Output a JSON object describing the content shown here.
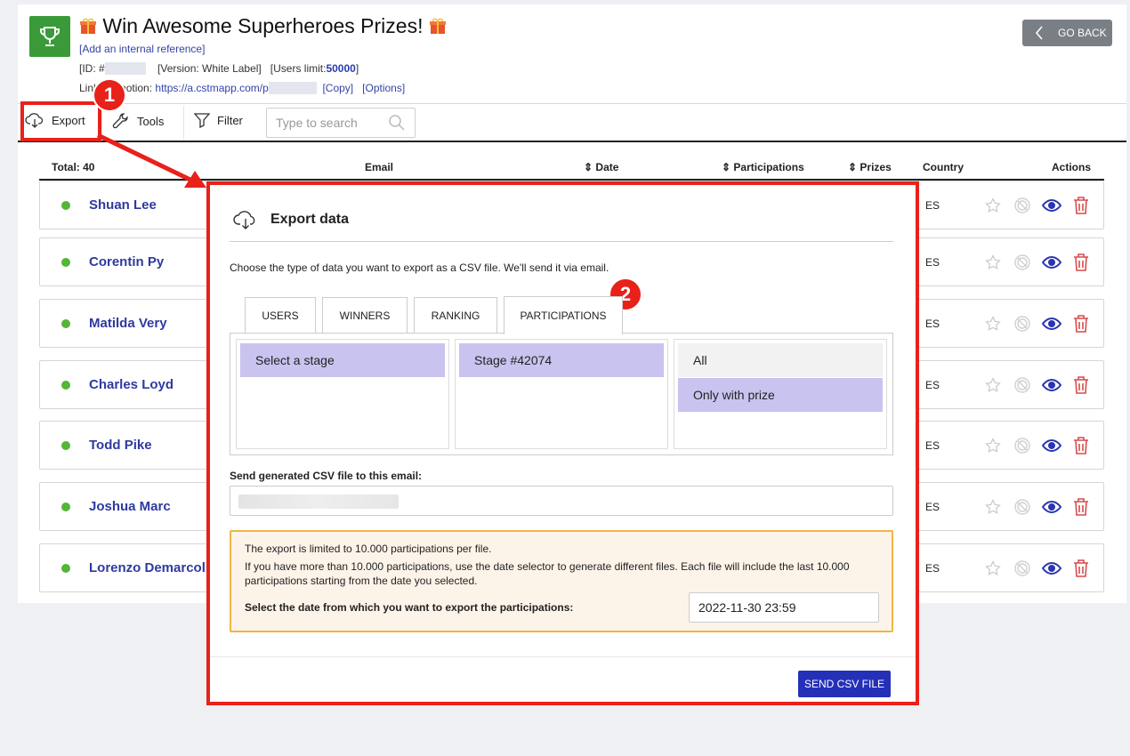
{
  "header": {
    "title": "Win Awesome Superheroes Prizes!",
    "add_reference": "[Add an internal reference]",
    "id_label": "[ID: #",
    "version": "[Version: White Label]",
    "users_limit_label": "[Users limit:",
    "users_limit_value": "50000",
    "users_limit_close": "]",
    "link_label": "Link promotion:",
    "link_url": "https://a.cstmapp.com/p",
    "copy": "[Copy]",
    "options": "[Options]",
    "go_back": "GO BACK"
  },
  "toolbar": {
    "export": "Export",
    "tools": "Tools",
    "filter": "Filter",
    "search_placeholder": "Type to search"
  },
  "table": {
    "total": "Total: 40",
    "columns": {
      "email": "Email",
      "date": "Date",
      "participations": "Participations",
      "prizes": "Prizes",
      "country": "Country",
      "actions": "Actions"
    },
    "rows": [
      {
        "name": "Shuan Lee",
        "country": "ES"
      },
      {
        "name": "Corentin Py",
        "country": "ES"
      },
      {
        "name": "Matilda Very",
        "country": "ES"
      },
      {
        "name": "Charles Loyd",
        "country": "ES"
      },
      {
        "name": "Todd Pike",
        "country": "ES"
      },
      {
        "name": "Joshua Marc",
        "country": "ES"
      },
      {
        "name": "Lorenzo Demarcoli",
        "country": "ES"
      }
    ]
  },
  "annotations": {
    "step1": "1",
    "step2": "2"
  },
  "modal": {
    "title": "Export data",
    "description": "Choose the type of data you want to export as a CSV file. We'll send it via email.",
    "tabs": [
      "USERS",
      "WINNERS",
      "RANKING",
      "PARTICIPATIONS"
    ],
    "active_tab": "PARTICIPATIONS",
    "col1_option": "Select a stage",
    "col2_option": "Stage #42074",
    "col3_options": [
      "All",
      "Only with prize"
    ],
    "email_label": "Send generated CSV file to this email:",
    "warning_line1": "The export is limited to 10.000 participations per file.",
    "warning_line2": "If you have more than 10.000 participations, use the date selector to generate different files. Each file will include the last 10.000 participations starting from the date you selected.",
    "warning_date_label": "Select the date from which you want to export the participations:",
    "date_value": "2022-11-30 23:59",
    "send_button": "SEND CSV FILE"
  },
  "colors": {
    "accent": "#2530b8",
    "annotation": "#e8211a",
    "status_active": "#55b534"
  }
}
